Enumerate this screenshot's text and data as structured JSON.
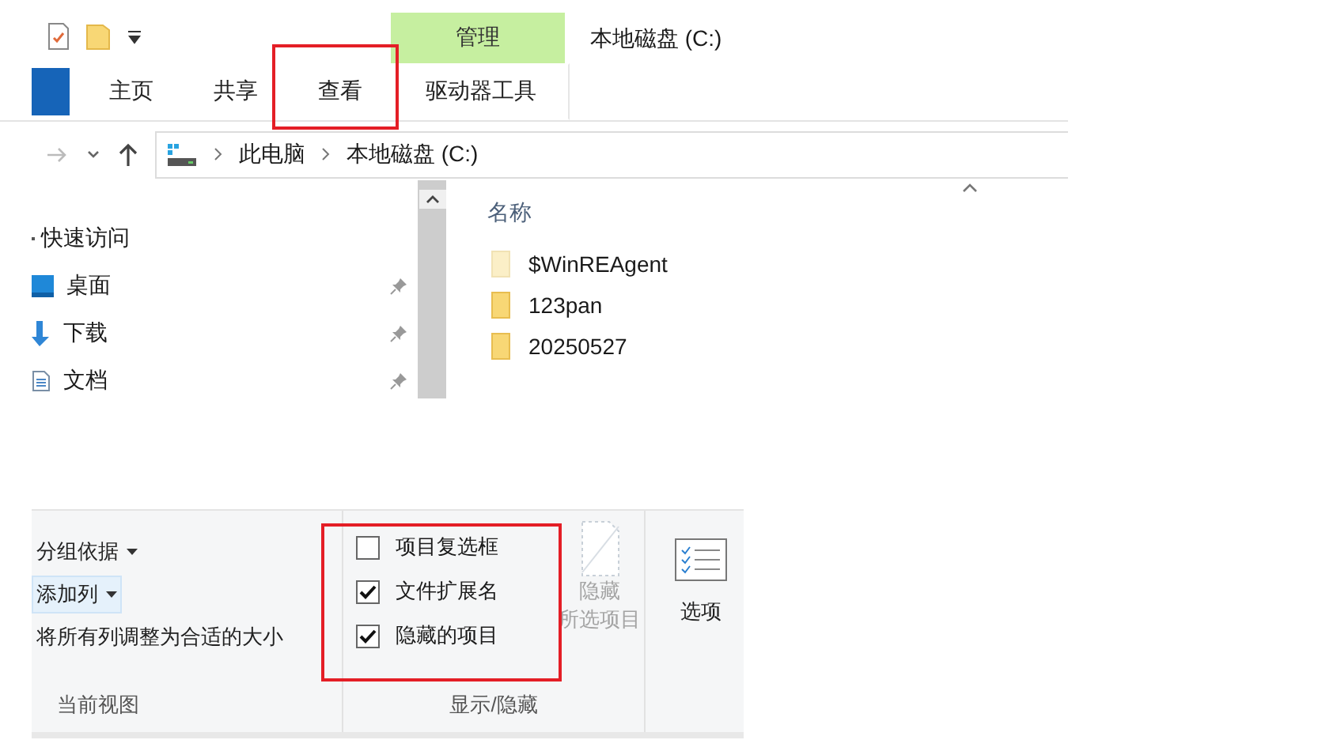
{
  "window": {
    "title": "本地磁盘 (C:)"
  },
  "contextual_tab_group": {
    "label": "管理"
  },
  "ribbon_tabs": [
    {
      "label": "主页",
      "selected": false,
      "highlighted": false
    },
    {
      "label": "共享",
      "selected": false,
      "highlighted": false
    },
    {
      "label": "查看",
      "selected": false,
      "highlighted": true
    },
    {
      "label": "驱动器工具",
      "selected": false,
      "highlighted": false
    }
  ],
  "address_bar": {
    "path": [
      "此电脑",
      "本地磁盘 (C:)"
    ]
  },
  "nav_pane": {
    "items": [
      {
        "label": "快速访问",
        "kind": "header",
        "pinned": false
      },
      {
        "label": "桌面",
        "kind": "desktop",
        "pinned": true
      },
      {
        "label": "下载",
        "kind": "download",
        "pinned": true
      },
      {
        "label": "文档",
        "kind": "document",
        "pinned": true
      }
    ]
  },
  "file_list": {
    "columns": [
      "名称"
    ],
    "items": [
      {
        "name": "$WinREAgent",
        "hidden": true
      },
      {
        "name": "123pan",
        "hidden": false
      },
      {
        "name": "20250527",
        "hidden": false
      }
    ]
  },
  "ribbon": {
    "groups": [
      {
        "kind": "current_view",
        "label": "当前视图",
        "commands": [
          {
            "label": "分组依据",
            "dropdown": true,
            "hover": false
          },
          {
            "label": "添加列",
            "dropdown": true,
            "hover": true
          },
          {
            "label": "将所有列调整为合适的大小",
            "dropdown": false,
            "hover": false
          }
        ]
      },
      {
        "kind": "show_hide",
        "label": "显示/隐藏",
        "highlighted": true,
        "checkboxes": [
          {
            "label": "项目复选框",
            "checked": false
          },
          {
            "label": "文件扩展名",
            "checked": true
          },
          {
            "label": "隐藏的项目",
            "checked": true
          }
        ],
        "button": {
          "label_lines": [
            "隐藏",
            "所选项目"
          ],
          "disabled": true
        }
      },
      {
        "kind": "options",
        "button": {
          "label": "选项"
        }
      }
    ]
  }
}
